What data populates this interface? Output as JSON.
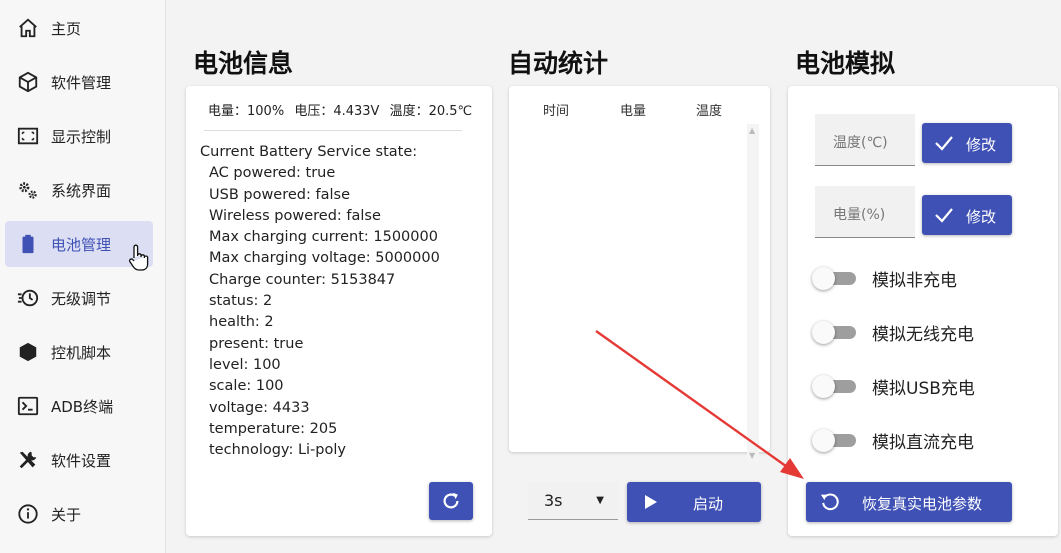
{
  "sidebar": {
    "items": [
      {
        "label": "主页",
        "icon": "home-icon"
      },
      {
        "label": "软件管理",
        "icon": "package-icon"
      },
      {
        "label": "显示控制",
        "icon": "display-icon"
      },
      {
        "label": "系统界面",
        "icon": "gears-icon"
      },
      {
        "label": "电池管理",
        "icon": "battery-icon",
        "active": true
      },
      {
        "label": "无级调节",
        "icon": "speed-clock-icon"
      },
      {
        "label": "控机脚本",
        "icon": "hexagon-icon"
      },
      {
        "label": "ADB终端",
        "icon": "terminal-icon"
      },
      {
        "label": "软件设置",
        "icon": "tools-icon"
      },
      {
        "label": "关于",
        "icon": "info-icon"
      }
    ]
  },
  "battery_info": {
    "title": "电池信息",
    "header": {
      "level": "电量：100%",
      "voltage": "电压：4.433V",
      "temperature": "温度：20.5℃"
    },
    "state_title": "Current Battery Service state:",
    "lines": [
      "AC powered: true",
      "USB powered: false",
      "Wireless powered: false",
      "Max charging current: 1500000",
      "Max charging voltage: 5000000",
      "Charge counter: 5153847",
      "status: 2",
      "health: 2",
      "present: true",
      "level: 100",
      "scale: 100",
      "voltage: 4433",
      "temperature: 205",
      "technology: Li-poly"
    ]
  },
  "auto_stats": {
    "title": "自动统计",
    "columns": [
      "时间",
      "电量",
      "温度"
    ],
    "interval": "3s",
    "start_label": "启动"
  },
  "battery_sim": {
    "title": "电池模拟",
    "temp_placeholder": "温度(℃)",
    "level_placeholder": "电量(%)",
    "edit_label": "修改",
    "toggles": [
      "模拟非充电",
      "模拟无线充电",
      "模拟USB充电",
      "模拟直流充电"
    ],
    "restore_label": "恢复真实电池参数"
  },
  "colors": {
    "accent": "#3f51b5",
    "active_bg": "#dcdff3",
    "annotation_arrow": "#e53935"
  }
}
